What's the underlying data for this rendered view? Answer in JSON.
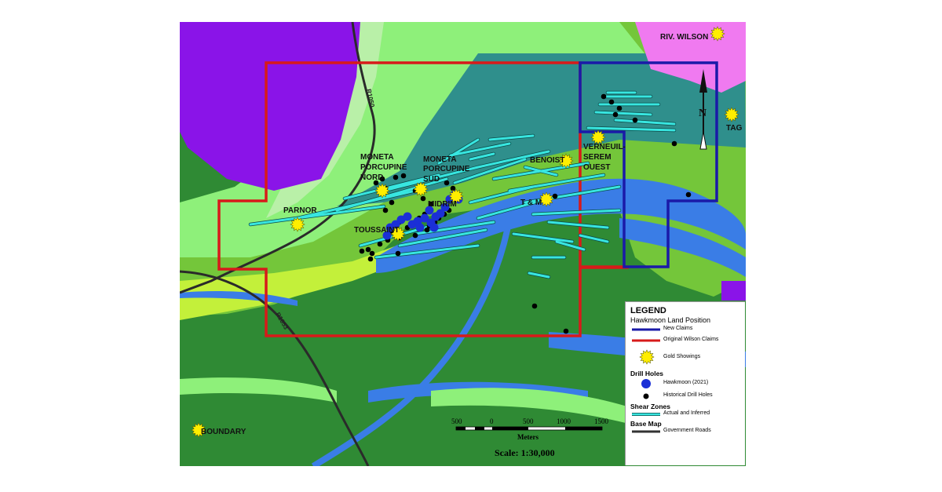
{
  "map": {
    "north_arrow_label": "N",
    "roads": [
      {
        "label": "R1050"
      },
      {
        "label": "R1053"
      }
    ],
    "showings": [
      {
        "label": "RIV. WILSON"
      },
      {
        "label": "TAG"
      },
      {
        "label": "PARNOR"
      },
      {
        "label": "TOUSSAINT"
      },
      {
        "label": "MIDRIM"
      },
      {
        "label": "T & M"
      },
      {
        "label": "BENOIST"
      },
      {
        "label": "BOUNDARY"
      }
    ],
    "multi_labels": {
      "moneta_nord": [
        "MONETA",
        "PORCUPINE",
        "NORD"
      ],
      "moneta_sud": [
        "MONETA",
        "PORCUPINE",
        "SUD"
      ],
      "verneuil": [
        "VERNEUIL-",
        "SEREM",
        "OUEST"
      ]
    },
    "scale_bar": {
      "ticks": [
        "500",
        "0",
        "500",
        "1000",
        "1500"
      ],
      "unit": "Meters",
      "scale_text": "Scale: 1:30,000"
    },
    "colors": {
      "new_claims": "#1a1aa8",
      "original_claims": "#d71a1a",
      "shear_zone": "#38e6e0",
      "gold_showing": "#ffee00",
      "hawkmoon_drill": "#1b2fd6",
      "historical_drill": "#000000",
      "road": "#333333"
    }
  },
  "legend": {
    "title": "LEGEND",
    "subtitle": "Hawkmoon Land Position",
    "items_land": [
      {
        "label": "New Claims",
        "color": "#1a1aa8"
      },
      {
        "label": "Original Wilson Claims",
        "color": "#d71a1a"
      }
    ],
    "gold_label": "Gold Showings",
    "drill_heading": "Drill Holes",
    "drill_items": [
      {
        "label": "Hawkmoon (2021)"
      },
      {
        "label": "Historical Drill Holes"
      }
    ],
    "shear_heading": "Shear Zones",
    "shear_label": "Actual and Inferred",
    "base_heading": "Base Map",
    "base_label": "Government Roads"
  }
}
